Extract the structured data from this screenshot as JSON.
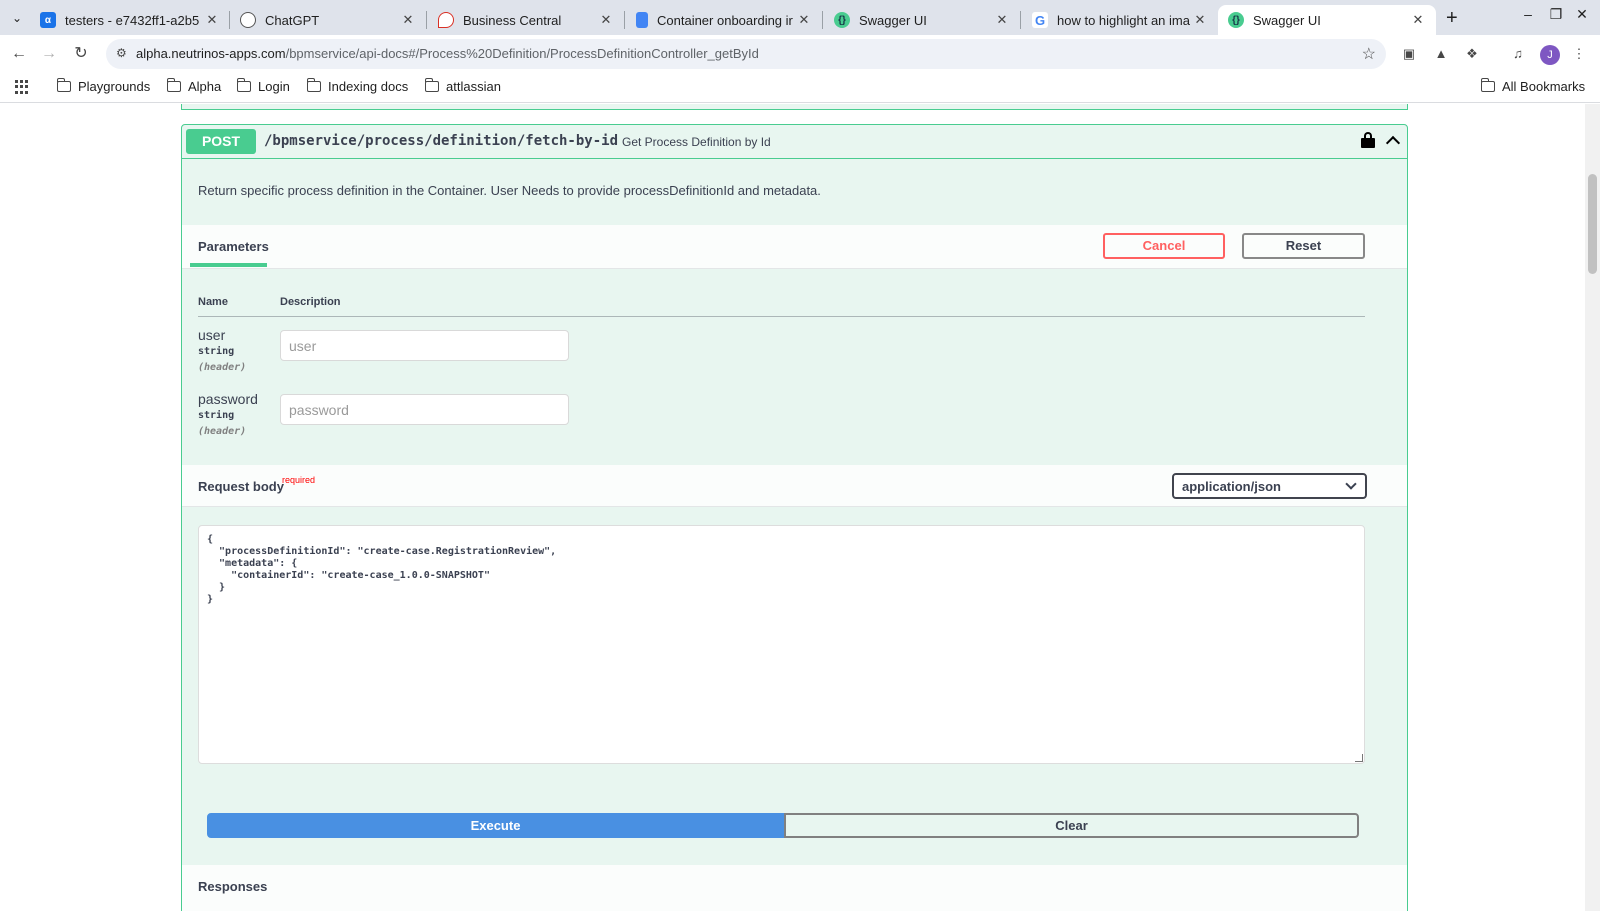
{
  "browser": {
    "tabs": [
      {
        "title": "testers - e7432ff1-a2b5",
        "favicon": "alpha-icon",
        "color": "#1a73e8"
      },
      {
        "title": "ChatGPT",
        "favicon": "chatgpt-icon",
        "color": "#555555"
      },
      {
        "title": "Business Central",
        "favicon": "business-central-icon",
        "color": "#d93025"
      },
      {
        "title": "Container onboarding ir",
        "favicon": "google-docs-icon",
        "color": "#4285f4"
      },
      {
        "title": "Swagger UI",
        "favicon": "swagger-icon",
        "color": "#49cc90"
      },
      {
        "title": "how to highlight an ima",
        "favicon": "google-icon",
        "color": "#4285f4"
      },
      {
        "title": "Swagger UI",
        "favicon": "swagger-icon",
        "color": "#49cc90",
        "active": true
      }
    ],
    "url_host": "alpha.neutrinos-apps.com",
    "url_path": "/bpmservice/api-docs#/Process%20Definition/ProcessDefinitionController_getById",
    "profile_initial": "J",
    "bookmarks": [
      "Playgrounds",
      "Alpha",
      "Login",
      "Indexing docs",
      "attlassian"
    ],
    "all_bookmarks_label": "All Bookmarks"
  },
  "operation": {
    "method": "POST",
    "path": "/bpmservice/process/definition/fetch-by-id",
    "summary": "Get Process Definition by Id",
    "description": "Return specific process definition in the Container. User Needs to provide processDefinitionId and metadata.",
    "method_color": "#49cc90"
  },
  "parameters": {
    "tab_label": "Parameters",
    "cancel_label": "Cancel",
    "reset_label": "Reset",
    "col_name": "Name",
    "col_description": "Description",
    "items": [
      {
        "name": "user",
        "type": "string",
        "in": "(header)",
        "placeholder": "user"
      },
      {
        "name": "password",
        "type": "string",
        "in": "(header)",
        "placeholder": "password"
      }
    ]
  },
  "request_body": {
    "title": "Request body",
    "required_label": "required",
    "content_type": "application/json",
    "value": "{\n  \"processDefinitionId\": \"create-case.RegistrationReview\",\n  \"metadata\": {\n    \"containerId\": \"create-case_1.0.0-SNAPSHOT\"\n  }\n}"
  },
  "actions": {
    "execute_label": "Execute",
    "clear_label": "Clear",
    "execute_color": "#4990e2"
  },
  "responses": {
    "title": "Responses"
  }
}
